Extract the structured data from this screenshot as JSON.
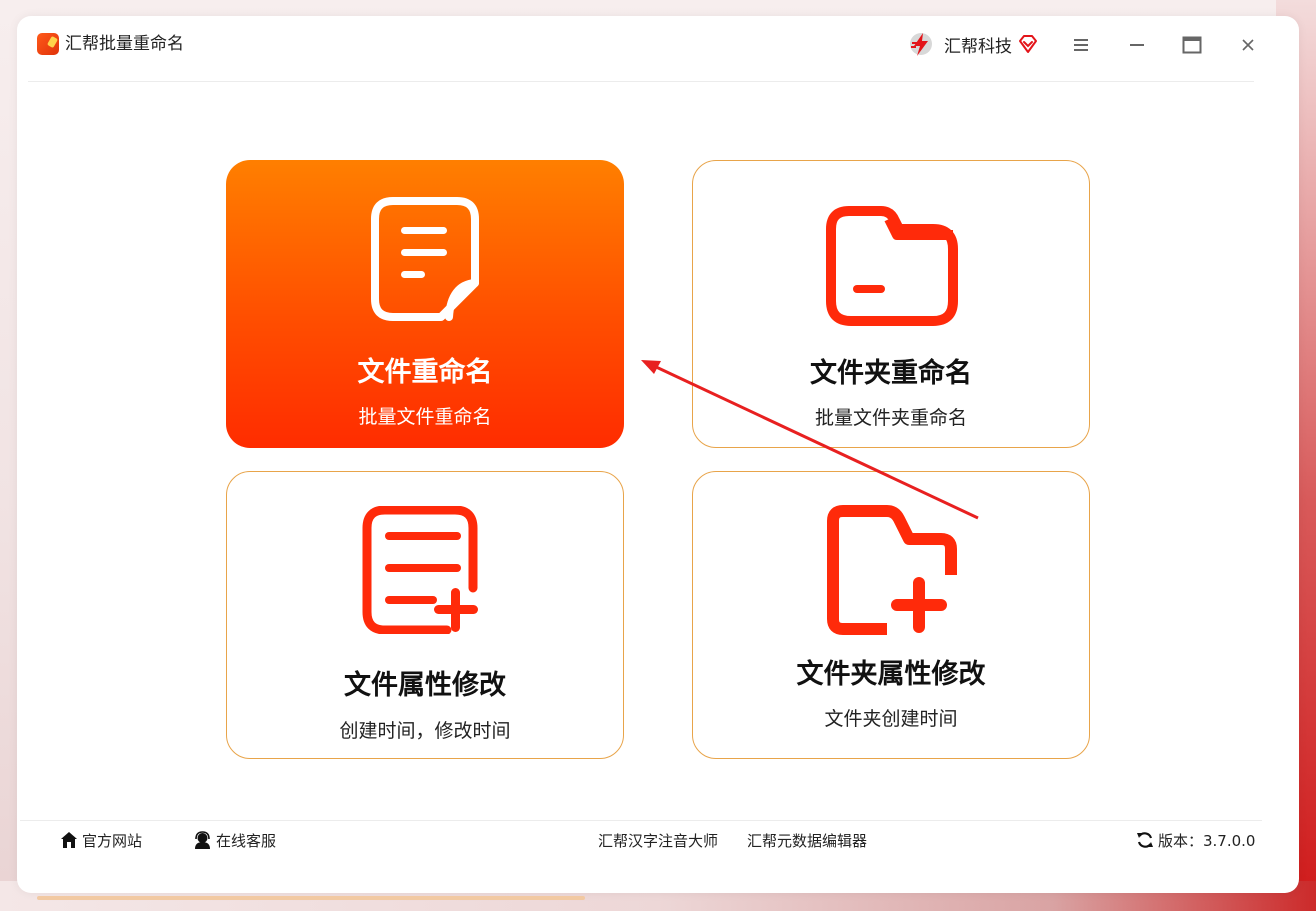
{
  "window": {
    "app_title": "汇帮批量重命名",
    "brand_name": "汇帮科技"
  },
  "icons": {
    "app_logo": "app-logo-icon",
    "brand_logo": "huibang-lightning-logo-icon",
    "vip": "vip-diamond-icon",
    "menu": "hamburger-menu-icon",
    "minimize": "minimize-icon",
    "maximize": "maximize-icon",
    "close": "close-icon",
    "home": "home-icon",
    "support": "headset-support-icon",
    "refresh": "refresh-icon"
  },
  "colors": {
    "accent": "#ff5a00",
    "icon_red": "#ff2a0a",
    "card_border": "#e8a44a",
    "active_gradient_top": "#ff7f00",
    "active_gradient_bottom": "#ff2c00"
  },
  "cards": [
    {
      "title": "文件重命名",
      "subtitle": "批量文件重命名",
      "icon": "document-icon",
      "active": true
    },
    {
      "title": "文件夹重命名",
      "subtitle": "批量文件夹重命名",
      "icon": "folder-icon",
      "active": false
    },
    {
      "title": "文件属性修改",
      "subtitle": "创建时间，修改时间",
      "icon": "document-add-icon",
      "active": false
    },
    {
      "title": "文件夹属性修改",
      "subtitle": "文件夹创建时间",
      "icon": "folder-add-icon",
      "active": false
    }
  ],
  "footer": {
    "website": "官方网站",
    "support": "在线客服",
    "link_pinyin": "汇帮汉字注音大师",
    "link_metadata": "汇帮元数据编辑器",
    "version": "版本：3.7.0.0"
  }
}
